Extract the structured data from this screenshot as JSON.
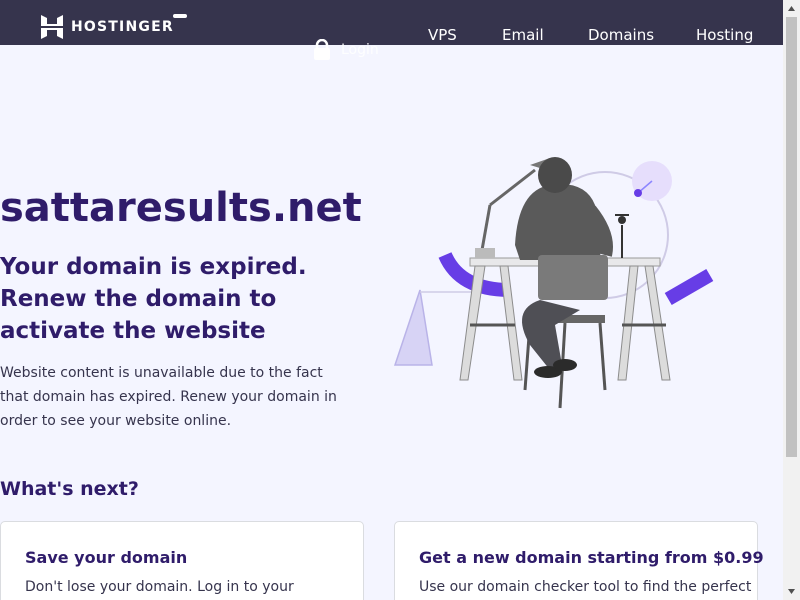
{
  "header": {
    "brand": "HOSTINGER",
    "nav": [
      {
        "label": "VPS"
      },
      {
        "label": "Email"
      },
      {
        "label": "Domains"
      },
      {
        "label": "Hosting"
      }
    ],
    "login_label": "Login",
    "background": "#36344d"
  },
  "hero": {
    "domain": "sattaresults.net",
    "headline": "Your domain is expired. Renew the domain to activate the website",
    "description": "Website content is unavailable due to the fact that domain has expired. Renew your domain in order to see your website online."
  },
  "next": {
    "heading": "What's next?",
    "cards": [
      {
        "title": "Save your domain",
        "text": "Don't lose your domain. Log in to your"
      },
      {
        "title": "Get a new domain starting from $0.99",
        "text": "Use our domain checker tool to find the perfect"
      }
    ]
  },
  "colors": {
    "primary_text": "#2f1c6a",
    "accent": "#673de6",
    "page_bg": "#f4f5ff"
  },
  "icons": {
    "logo": "hostinger-logo-icon",
    "menu": "menu-toggle-icon",
    "login": "lock-icon"
  }
}
